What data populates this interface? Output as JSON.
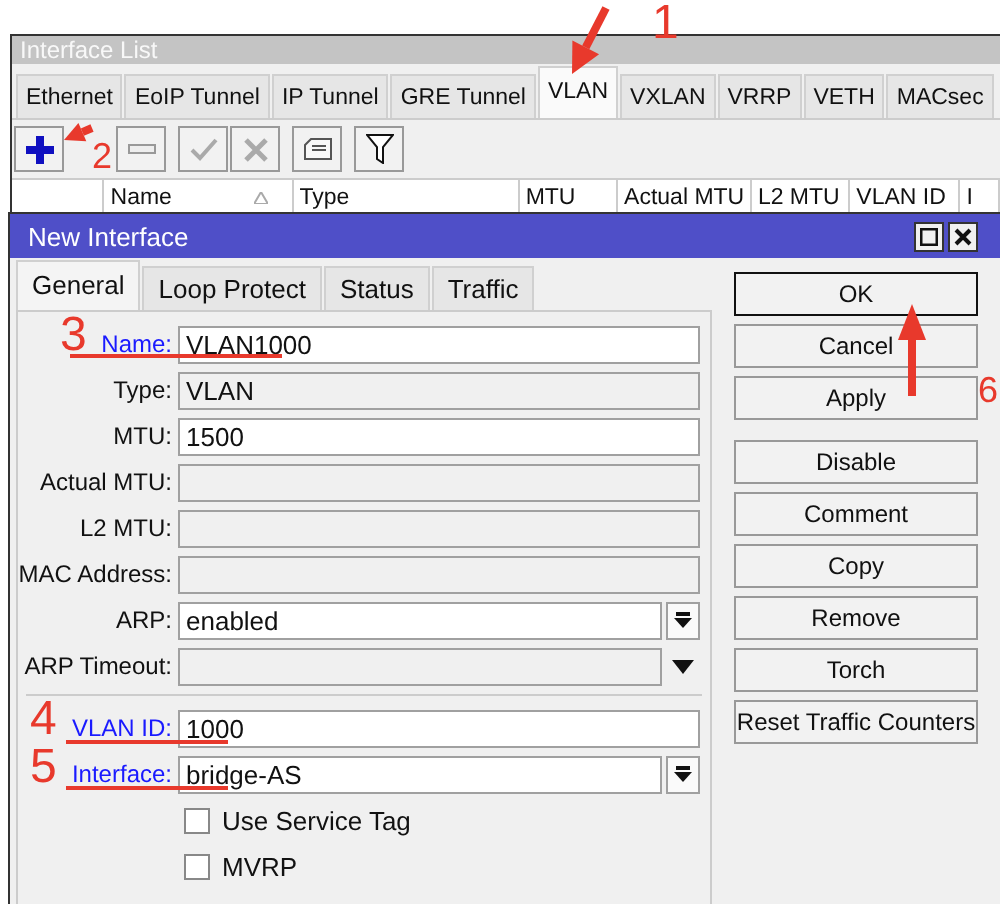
{
  "window": {
    "title": "Interface List"
  },
  "tabs": [
    {
      "label": "Ethernet",
      "selected": false
    },
    {
      "label": "EoIP Tunnel",
      "selected": false
    },
    {
      "label": "IP Tunnel",
      "selected": false
    },
    {
      "label": "GRE Tunnel",
      "selected": false
    },
    {
      "label": "VLAN",
      "selected": true
    },
    {
      "label": "VXLAN",
      "selected": false
    },
    {
      "label": "VRRP",
      "selected": false
    },
    {
      "label": "VETH",
      "selected": false
    },
    {
      "label": "MACsec",
      "selected": false
    }
  ],
  "table": {
    "columns": [
      "Name",
      "Type",
      "MTU",
      "Actual MTU",
      "L2 MTU",
      "VLAN ID",
      "I"
    ]
  },
  "dialog": {
    "title": "New Interface",
    "tabs": [
      {
        "label": "General",
        "selected": true
      },
      {
        "label": "Loop Protect",
        "selected": false
      },
      {
        "label": "Status",
        "selected": false
      },
      {
        "label": "Traffic",
        "selected": false
      }
    ],
    "sections": [
      [
        {
          "label": "Name:",
          "value": "VLAN1000",
          "kind": "text",
          "link": true
        },
        {
          "label": "Type:",
          "value": "VLAN",
          "kind": "readonly",
          "link": false
        },
        {
          "label": "MTU:",
          "value": "1500",
          "kind": "text",
          "link": false
        },
        {
          "label": "Actual MTU:",
          "kind": "readonly",
          "link": false
        },
        {
          "label": "L2 MTU:",
          "kind": "readonly",
          "link": false
        },
        {
          "label": "MAC Address:",
          "kind": "readonly",
          "link": false
        },
        {
          "label": "ARP:",
          "value": "enabled",
          "kind": "dropdown",
          "link": false
        },
        {
          "label": "ARP Timeout:",
          "kind": "optional",
          "link": false
        }
      ],
      [
        {
          "label": "VLAN ID:",
          "value": "1000",
          "kind": "text",
          "link": true
        },
        {
          "label": "Interface:",
          "value": "bridge-AS",
          "kind": "dropdown",
          "link": true
        },
        {
          "label": "Use Service Tag",
          "kind": "checkbox",
          "checked": false
        },
        {
          "label": "MVRP",
          "kind": "checkbox",
          "checked": false
        }
      ]
    ],
    "button_groups": [
      [
        {
          "label": "OK",
          "default": true
        },
        {
          "label": "Cancel",
          "default": false
        },
        {
          "label": "Apply",
          "default": false
        }
      ],
      [
        {
          "label": "Disable",
          "default": false
        },
        {
          "label": "Comment",
          "default": false
        },
        {
          "label": "Copy",
          "default": false
        },
        {
          "label": "Remove",
          "default": false
        },
        {
          "label": "Torch",
          "default": false
        },
        {
          "label": "Reset Traffic Counters",
          "default": false
        }
      ]
    ]
  },
  "annotations": [
    {
      "label": "1"
    },
    {
      "label": "2"
    },
    {
      "label": "3"
    },
    {
      "label": "4"
    },
    {
      "label": "5"
    },
    {
      "label": "6"
    }
  ]
}
